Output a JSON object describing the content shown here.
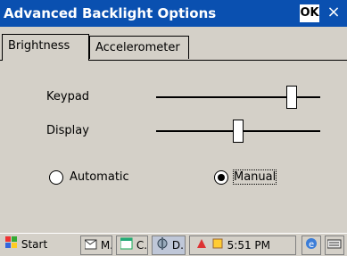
{
  "window": {
    "title": "Advanced Backlight Options",
    "ok_label": "OK",
    "close_label": "×"
  },
  "tabs": [
    {
      "label": "Brightness",
      "active": true
    },
    {
      "label": "Accelerometer",
      "active": false
    }
  ],
  "sliders": [
    {
      "label": "Keypad",
      "value": 0.85
    },
    {
      "label": "Display",
      "value": 0.5
    }
  ],
  "radios": [
    {
      "label": "Automatic",
      "selected": false
    },
    {
      "label": "Manual",
      "selected": true
    }
  ],
  "taskbar": {
    "start_label": "Start",
    "items": [
      {
        "label": "M.",
        "icon": "mail-icon"
      },
      {
        "label": "C.",
        "icon": "calendar-icon"
      },
      {
        "label": "D.",
        "icon": "settings-icon"
      }
    ],
    "clock": "5:51 PM"
  }
}
